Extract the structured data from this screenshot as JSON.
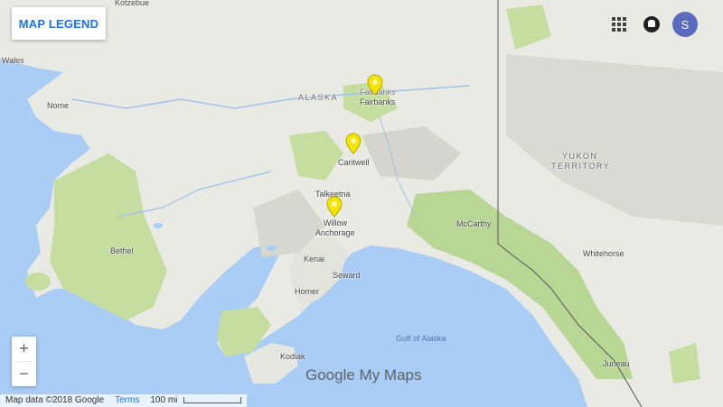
{
  "controls": {
    "legend_label": "MAP LEGEND",
    "avatar_letter": "S",
    "zoom_in": "+",
    "zoom_out": "−"
  },
  "map": {
    "brand": "Google My Maps",
    "attribution": "Map data ©2018 Google",
    "terms": "Terms",
    "scale": "100 mi",
    "labels": {
      "kotzebue": "Kotzebue",
      "wales": "Wales",
      "nome": "Nome",
      "bethel": "Bethel",
      "alaska": "ALASKA",
      "fairbanks_top": "Fairbanks",
      "fairbanks": "Fairbanks",
      "cantwell": "Cantwell",
      "talkeetna": "Talkeetna",
      "willow": "Willow",
      "anchorage": "Anchorage",
      "kenai": "Kenai",
      "seward": "Seward",
      "homer": "Homer",
      "kodiak": "Kodiak",
      "mccarthy": "McCarthy",
      "whitehorse": "Whitehorse",
      "juneau": "Juneau",
      "yukon1": "YUKON",
      "yukon2": "TERRITORY",
      "gulf": "Gulf of Alaska"
    },
    "pin_color": "#f5e500"
  }
}
